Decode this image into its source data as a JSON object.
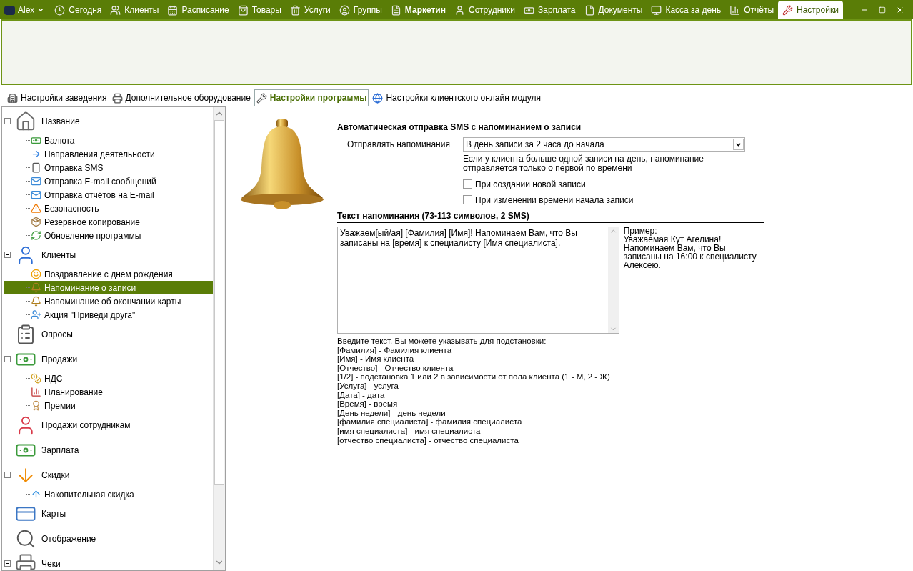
{
  "user_menu": {
    "label": "Alex"
  },
  "nav_tabs": [
    {
      "label": "Сегодня",
      "selected": false,
      "bold": false
    },
    {
      "label": "Клиенты",
      "selected": false,
      "bold": false
    },
    {
      "label": "Расписание",
      "selected": false,
      "bold": false
    },
    {
      "label": "Товары",
      "selected": false,
      "bold": false
    },
    {
      "label": "Услуги",
      "selected": false,
      "bold": false
    },
    {
      "label": "Группы",
      "selected": false,
      "bold": false
    },
    {
      "label": "Маркетин",
      "selected": false,
      "bold": true
    },
    {
      "label": "Сотрудники",
      "selected": false,
      "bold": false
    },
    {
      "label": "Зарплата",
      "selected": false,
      "bold": false
    },
    {
      "label": "Документы",
      "selected": false,
      "bold": false
    },
    {
      "label": "Касса за день",
      "selected": false,
      "bold": false
    },
    {
      "label": "Отчёты",
      "selected": false,
      "bold": false
    },
    {
      "label": "Настройки",
      "selected": true,
      "bold": false
    }
  ],
  "sub_tabs": [
    {
      "label": "Настройки заведения",
      "selected": false
    },
    {
      "label": "Дополнительное оборудование",
      "selected": false
    },
    {
      "label": "Настройки программы",
      "selected": true
    },
    {
      "label": "Настройки клиентского онлайн модуля",
      "selected": false
    }
  ],
  "tree": [
    {
      "label": "Название",
      "expanded": true,
      "children": [
        {
          "label": "Валюта",
          "selected": false
        },
        {
          "label": "Направления деятельности",
          "selected": false
        },
        {
          "label": "Отправка SMS",
          "selected": false
        },
        {
          "label": "Отправка E-mail сообщений",
          "selected": false
        },
        {
          "label": "Отправка отчётов на E-mail",
          "selected": false
        },
        {
          "label": "Безопасность",
          "selected": false
        },
        {
          "label": "Резервное копирование",
          "selected": false
        },
        {
          "label": "Обновление программы",
          "selected": false
        }
      ]
    },
    {
      "label": "Клиенты",
      "expanded": true,
      "children": [
        {
          "label": "Поздравление с днем рождения",
          "selected": false
        },
        {
          "label": "Напоминание о записи",
          "selected": true
        },
        {
          "label": "Напоминание об окончании карты",
          "selected": false
        },
        {
          "label": "Акция \"Приведи друга\"",
          "selected": false
        }
      ]
    },
    {
      "label": "Опросы"
    },
    {
      "label": "Продажи",
      "expanded": true,
      "children": [
        {
          "label": "НДС",
          "selected": false
        },
        {
          "label": "Планирование",
          "selected": false
        },
        {
          "label": "Премии",
          "selected": false
        }
      ]
    },
    {
      "label": "Продажи сотрудникам"
    },
    {
      "label": "Зарплата"
    },
    {
      "label": "Скидки",
      "expanded": true,
      "children": [
        {
          "label": "Накопительная скидка",
          "selected": false
        }
      ]
    },
    {
      "label": "Карты"
    },
    {
      "label": "Отображение"
    },
    {
      "label": "Чеки",
      "expanded": true
    }
  ],
  "auto_send": {
    "heading": "Автоматическая отправка SMS с напоминанием о записи",
    "send_label": "Отправлять напоминания",
    "send_value": "В день записи за 2 часа до начала",
    "note": "Если у клиента больше одной записи на день, напоминание отправляется только о первой по времени",
    "options": [
      {
        "label": "При создании новой записи",
        "checked": false
      },
      {
        "label": "При изменении времени начала записи",
        "checked": false
      }
    ]
  },
  "reminder_text": {
    "heading": "Текст напоминания (73-113 символов, 2 SMS)",
    "value": "Уважаем[ый/ая] [Фамилия] [Имя]! Напоминаем Вам, что Вы записаны на [время] к специалисту [Имя специалиста].",
    "example_label": "Пример:",
    "example_lines": [
      "Уважаемая Кут Агелина!",
      "Напоминаем Вам, что Вы записаны на 16:00 к специалисту Алексею."
    ]
  },
  "help_lines": [
    "Введите текст. Вы можете указывать для подстановки:",
    "[Фамилия] - Фамилия клиента",
    "[Имя] - Имя клиента",
    "[Отчество] - Отчество клиента",
    "[1/2] - подстановка 1 или 2 в зависимости от пола клиента (1 - М, 2 - Ж)",
    "[Услуга] - услуга",
    "[Дата] - дата",
    "[Время] - время",
    "[День недели] - день недели",
    "[фамилия специалиста] - фамилия специалиста",
    "[имя специалиста] - имя специалиста",
    "[отчество специалиста] - отчество специалиста"
  ]
}
